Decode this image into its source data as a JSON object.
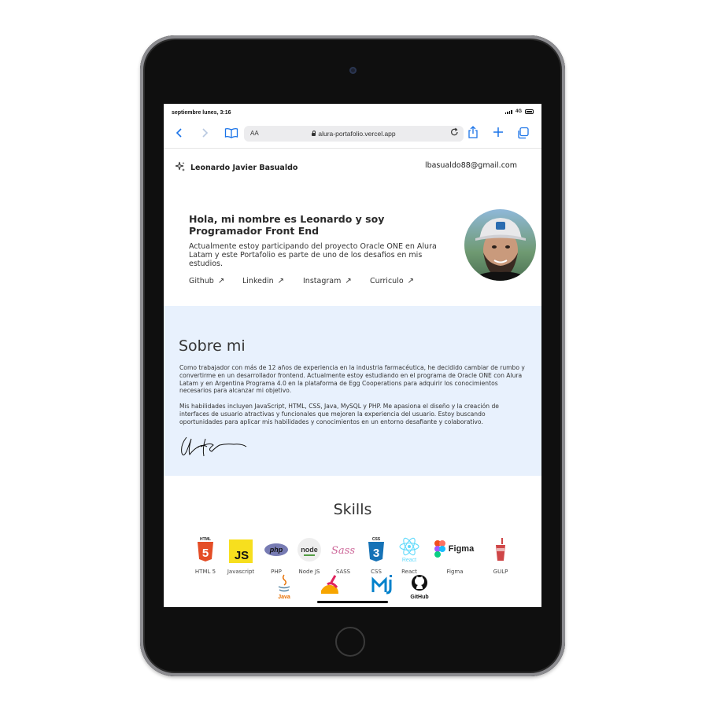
{
  "status_bar": {
    "time": "septiembre lunes, 3:16",
    "network": "4G"
  },
  "browser": {
    "aa_label": "AA",
    "url": "alura-portafolio.vercel.app"
  },
  "header": {
    "name": "Leonardo Javier Basualdo",
    "email": "lbasualdo88@gmail.com"
  },
  "hero": {
    "title": "Hola, mi nombre es Leonardo y soy Programador Front End",
    "description": "Actualmente estoy participando del proyecto Oracle ONE en Alura Latam y este Portafolio es parte de uno de los desafios en mis estudios.",
    "links": [
      {
        "label": "Github",
        "arrow": "↗"
      },
      {
        "label": "Linkedin",
        "arrow": "↗"
      },
      {
        "label": "Instagram",
        "arrow": "↗"
      },
      {
        "label": "Curriculo",
        "arrow": "↗"
      }
    ]
  },
  "about": {
    "title": "Sobre mi",
    "paragraph1": "Como trabajador con más de 12 años de experiencia en la industria farmacéutica, he decidido cambiar de rumbo y convertirme en un desarrollador frontend. Actualmente estoy estudiando en el programa de Oracle ONE con Alura Latam y en Argentina Programa 4.0 en la plataforma de Egg Cooperations para adquirir los conocimientos necesarios para alcanzar mi objetivo.",
    "paragraph2": "Mis habilidades incluyen JavaScript, HTML, CSS, Java, MySQL y PHP. Me apasiona el diseño y la creación de interfaces de usuario atractivas y funcionales que mejoren la experiencia del usuario. Estoy buscando oportunidades para aplicar mis habilidades y conocimientos en un entorno desafiante y colaborativo."
  },
  "skills": {
    "title": "Skills",
    "items": [
      {
        "label": "HTML 5",
        "icon_text": "HTML",
        "icon": "html5-icon",
        "color": "#e44d26"
      },
      {
        "label": "Javascript",
        "icon_text": "JS",
        "icon": "javascript-icon",
        "color": "#f7df1e"
      },
      {
        "label": "PHP",
        "icon_text": "php",
        "icon": "php-icon",
        "color": "#777bb3"
      },
      {
        "label": "Node JS",
        "icon_text": "node",
        "icon": "nodejs-icon",
        "color": "#539e43"
      },
      {
        "label": "SASS",
        "icon_text": "Sass",
        "icon": "sass-icon",
        "color": "#cd6799"
      },
      {
        "label": "CSS",
        "icon_text": "CSS",
        "icon": "css3-icon",
        "color": "#1572b6"
      },
      {
        "label": "React",
        "icon_text": "React",
        "icon": "react-icon",
        "color": "#61dafb"
      },
      {
        "label": "Figma",
        "icon_text": "Figma",
        "icon": "figma-icon",
        "color": "#f24e1e"
      },
      {
        "label": "GULP",
        "icon_text": "",
        "icon": "gulp-icon",
        "color": "#cf4647"
      }
    ],
    "row2": [
      {
        "icon_text": "Java",
        "icon": "java-icon",
        "color": "#e76f00"
      },
      {
        "icon_text": "",
        "icon": "bootstrap-icon",
        "color": "#e0245e"
      },
      {
        "icon_text": "",
        "icon": "materialize-icon",
        "color": "#0081cb"
      },
      {
        "icon_text": "GitHub",
        "icon": "github-icon",
        "color": "#111111"
      }
    ]
  }
}
